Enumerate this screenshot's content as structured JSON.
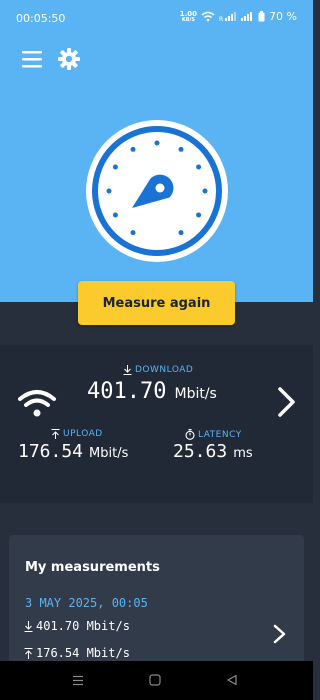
{
  "status_bar": {
    "time": "00:05:50",
    "net_speed_value": "1.00",
    "net_speed_unit": "KB/S",
    "battery": "70 %",
    "icons": [
      "wifi-icon",
      "signal-r-icon",
      "signal-icon",
      "battery-icon"
    ]
  },
  "toolbar": {
    "menu_icon": "hamburger-menu-icon",
    "settings_icon": "gear-icon"
  },
  "gauge_icon": "speedometer-gauge-icon",
  "measure_button": {
    "label": "Measure again"
  },
  "results": {
    "download_label": "DOWNLOAD",
    "download_value": "401.70",
    "download_unit": "Mbit/s",
    "upload_label": "UPLOAD",
    "upload_value": "176.54",
    "upload_unit": "Mbit/s",
    "latency_label": "LATENCY",
    "latency_value": "25.63",
    "latency_unit": "ms"
  },
  "measurements": {
    "title": "My measurements",
    "items": [
      {
        "date": "3 MAY 2025, 00:05",
        "download": "401.70 Mbit/s",
        "upload": "176.54 Mbit/s"
      }
    ]
  },
  "colors": {
    "accent_blue": "#5ab4f3",
    "gauge_blue": "#1a73d4",
    "button_yellow": "#fbca2d",
    "dark_bg": "#272f3d",
    "results_bg": "#212937",
    "card_bg": "#323b4a"
  }
}
